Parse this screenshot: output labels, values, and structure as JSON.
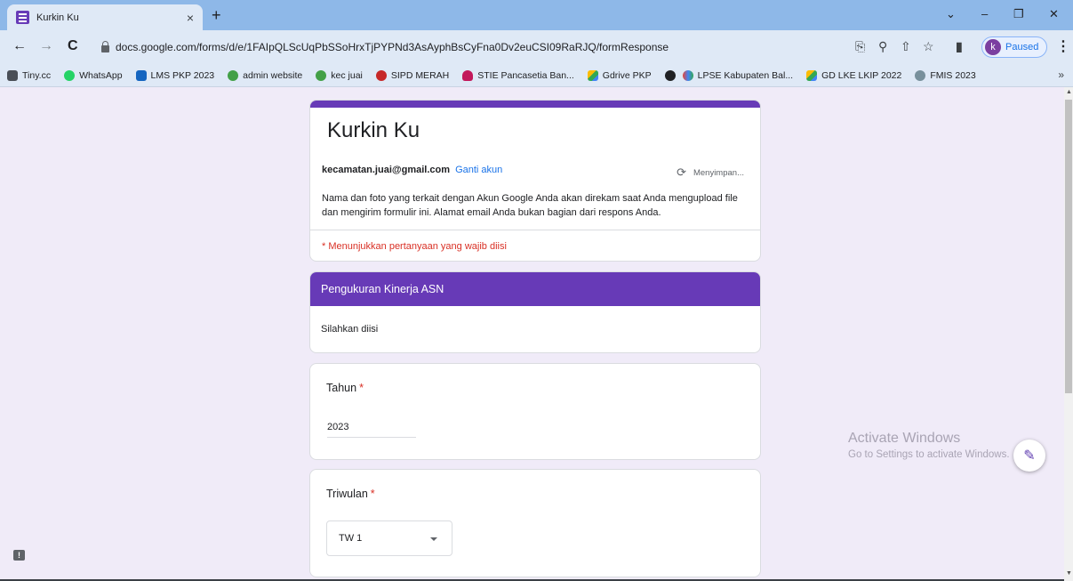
{
  "browser": {
    "tab_title": "Kurkin Ku",
    "tab_close": "×",
    "new_tab": "+",
    "window_controls": [
      "⌄",
      "–",
      "❐",
      "✕"
    ],
    "nav": {
      "back": "←",
      "forward": "→",
      "reload": "C"
    },
    "url": "docs.google.com/forms/d/e/1FAIpQLScUqPbSSoHrxTjPYPNd3AsAyphBsCyFna0Dv2euCSI09RaRJQ/formResponse",
    "toolbar_icons": [
      "translate-icon",
      "zoom-icon",
      "share-icon",
      "star-icon",
      "sidepanel-icon"
    ],
    "profile": {
      "initial": "k",
      "status": "Paused"
    },
    "menu": "⋮"
  },
  "bookmarks": [
    {
      "label": "Tiny.cc",
      "color": "#4a4f57"
    },
    {
      "label": "WhatsApp",
      "color": "#25d366"
    },
    {
      "label": "LMS PKP 2023",
      "color": "#1565c0"
    },
    {
      "label": "admin website",
      "color": "#43a047"
    },
    {
      "label": "kec juai",
      "color": "#43a047"
    },
    {
      "label": "SIPD MERAH",
      "color": "#c62828"
    },
    {
      "label": "STIE Pancasetia Ban...",
      "color": "#c2185b"
    },
    {
      "label": "Gdrive PKP",
      "color": "#fbbc04"
    },
    {
      "label": "",
      "color": "#202124"
    },
    {
      "label": "LPSE Kabupaten Bal...",
      "color": "#34a853"
    },
    {
      "label": "GD LKE LKIP 2022",
      "color": "#fbbc04"
    },
    {
      "label": "FMIS 2023",
      "color": "#78909c"
    }
  ],
  "bookmarks_more": "»",
  "form": {
    "title": "Kurkin Ku",
    "email": "kecamatan.juai@gmail.com",
    "switch_account": "Ganti akun",
    "saving": "Menyimpan...",
    "notice": "Nama dan foto yang terkait dengan Akun Google Anda akan direkam saat Anda mengupload file dan mengirim formulir ini. Alamat email Anda bukan bagian dari respons Anda.",
    "required_note": "* Menunjukkan pertanyaan yang wajib diisi",
    "section_title": "Pengukuran Kinerja ASN",
    "section_description": "Silahkan diisi",
    "questions": [
      {
        "label": "Tahun",
        "required_mark": "*",
        "answer": "2023"
      },
      {
        "label": "Triwulan",
        "required_mark": "*",
        "selected": "TW 1"
      }
    ],
    "accent_color": "#673ab7",
    "required_color": "#d93025"
  },
  "watermark": {
    "title": "Activate Windows",
    "subtitle": "Go to Settings to activate Windows."
  }
}
